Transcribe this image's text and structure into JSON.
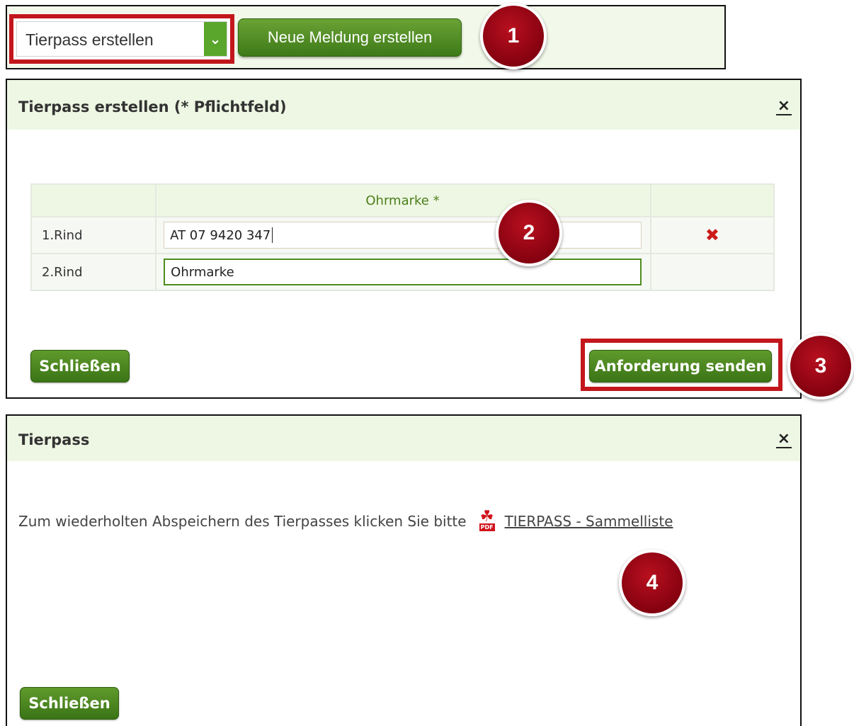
{
  "toolbar": {
    "select_value": "Tierpass erstellen",
    "new_report_button": "Neue Meldung erstellen"
  },
  "badges": [
    "1",
    "2",
    "3",
    "4"
  ],
  "dialog_create": {
    "title": "Tierpass erstellen (* Pflichtfeld)",
    "close_symbol": "×",
    "table": {
      "header_ear_tag": "Ohrmarke *",
      "rows": [
        {
          "label": "1.Rind",
          "value": "AT 07 9420 347",
          "delete": "✖"
        },
        {
          "label": "2.Rind",
          "value": "Ohrmarke"
        }
      ]
    },
    "close_button": "Schließen",
    "send_button": "Anforderung senden"
  },
  "dialog_result": {
    "title": "Tierpass",
    "close_symbol": "×",
    "message": "Zum wiederholten Abspeichern des Tierpasses klicken Sie bitte",
    "pdf_tag": "PDF",
    "link_text": "TIERPASS - Sammelliste",
    "close_button": "Schließen"
  },
  "colors": {
    "highlight_red": "#c3161c",
    "button_green": "#4a8820",
    "header_green": "#eef7e3",
    "badge_red": "#9e0a17"
  }
}
